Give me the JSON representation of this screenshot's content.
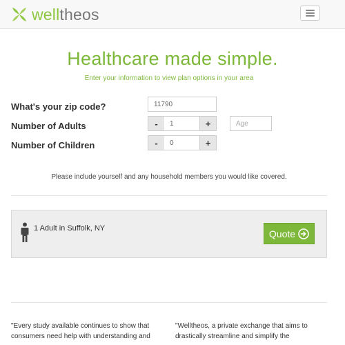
{
  "navbar": {
    "logo_well": "well",
    "logo_theos": "theos",
    "logo_icon": "x-leaf-icon",
    "menu_icon": "hamburger-icon",
    "brand_green": "#8dc63f"
  },
  "hero": {
    "title": "Healthcare made simple.",
    "subtitle": "Enter your information to view plan options in your area"
  },
  "form": {
    "zip_label": "What's your zip code?",
    "zip_value": "11790",
    "adults_label": "Number of Adults",
    "adults_value": "1",
    "adults_minus": "-",
    "adults_plus": "+",
    "age_placeholder": "Age",
    "children_label": "Number of Children",
    "children_value": "0",
    "children_minus": "-",
    "children_plus": "+"
  },
  "note": "Please include yourself and any household members you would like covered.",
  "quote_panel": {
    "person_icon": "person-icon",
    "summary": "1 Adult in Suffolk, NY",
    "button_label": "Quote",
    "button_icon": "arrow-circle-right-icon",
    "button_color": "#7db83a"
  },
  "testimonials": {
    "left": "\"Every study available continues to show that consumers need help with understanding and",
    "right": "\"Welltheos, a private exchange that aims to drastically streamline and simplify the"
  }
}
